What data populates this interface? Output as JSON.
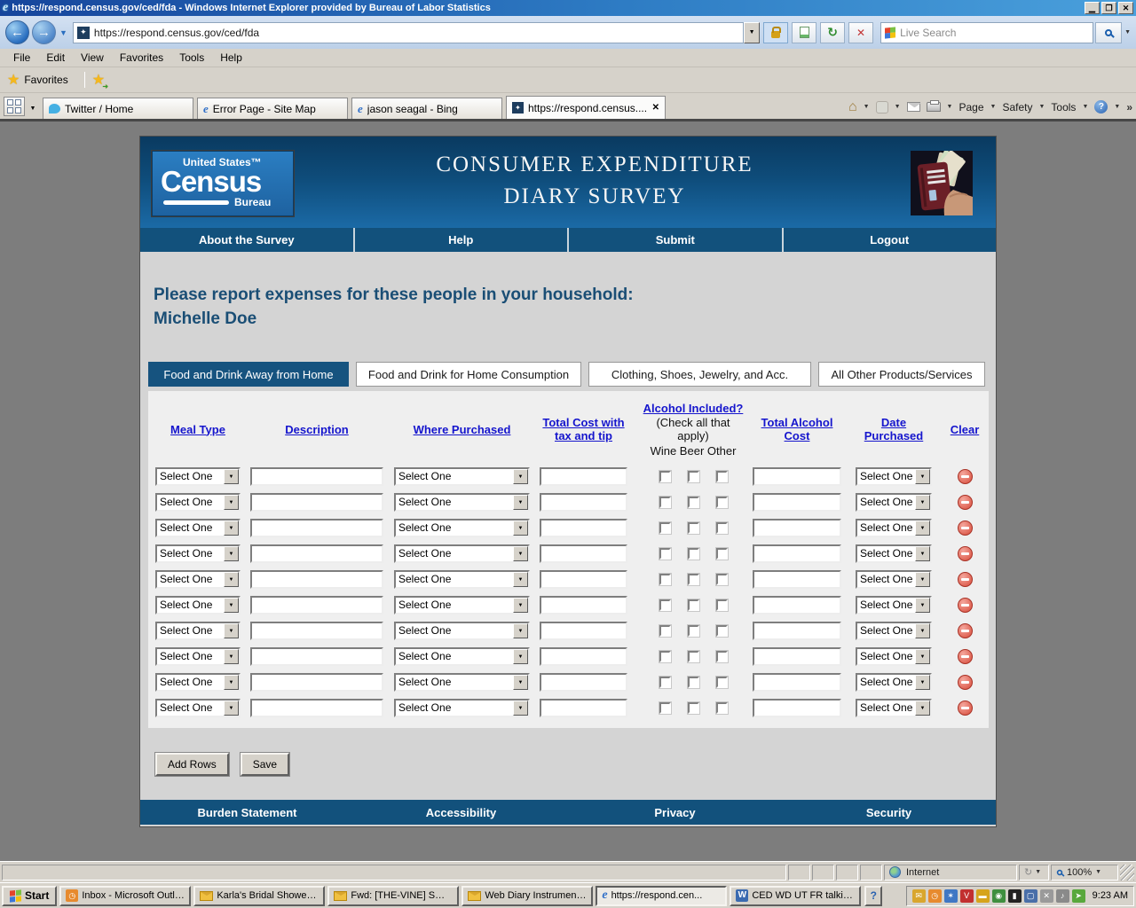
{
  "window": {
    "title": "https://respond.census.gov/ced/fda - Windows Internet Explorer provided by Bureau of Labor Statistics"
  },
  "browser": {
    "address_url": "https://respond.census.gov/ced/fda",
    "search": {
      "placeholder": "Live Search"
    },
    "menu_items": [
      "File",
      "Edit",
      "View",
      "Favorites",
      "Tools",
      "Help"
    ],
    "favorites_label": "Favorites",
    "tabs": [
      {
        "label": "Twitter / Home",
        "icon": "twitter",
        "active": false
      },
      {
        "label": "Error Page - Site Map",
        "icon": "ie",
        "active": false
      },
      {
        "label": "jason seagal - Bing",
        "icon": "ie",
        "active": false
      },
      {
        "label": "https://respond.census....",
        "icon": "census",
        "active": true
      }
    ],
    "toolbar": {
      "page_label": "Page",
      "safety_label": "Safety",
      "tools_label": "Tools"
    },
    "status": {
      "zone": "Internet",
      "zoom_level": "100%"
    }
  },
  "survey": {
    "logo": {
      "top": "United States™",
      "main": "Census",
      "sub": "Bureau"
    },
    "title_line1": "CONSUMER EXPENDITURE",
    "title_line2": "DIARY SURVEY",
    "nav_items": [
      "About the Survey",
      "Help",
      "Submit",
      "Logout"
    ],
    "heading_line1": "Please report expenses for these people in your household:",
    "heading_line2": "Michelle Doe",
    "category_tabs": [
      {
        "label": "Food and Drink Away from Home",
        "active": true
      },
      {
        "label": "Food and Drink for Home Consumption",
        "active": false
      },
      {
        "label": "Clothing, Shoes, Jewelry, and Acc.",
        "active": false
      },
      {
        "label": "All Other Products/Services",
        "active": false
      }
    ],
    "table": {
      "headers": {
        "meal_type": "Meal Type",
        "description": "Description",
        "where_purchased": "Where Purchased",
        "total_cost": "Total Cost with tax and tip",
        "alcohol_included": "Alcohol Included?",
        "alcohol_note": "(Check all that apply)",
        "alcohol_options": "Wine Beer Other",
        "total_alcohol_cost": "Total Alcohol Cost",
        "date_purchased": "Date Purchased",
        "clear": "Clear"
      },
      "rows": [
        {
          "meal_type": "Select One",
          "description": "",
          "where_purchased": "Select One",
          "total_cost": "",
          "wine_checked": false,
          "beer_checked": false,
          "other_checked": false,
          "total_alcohol_cost": "",
          "date_purchased": "Select One"
        },
        {
          "meal_type": "Select One",
          "description": "",
          "where_purchased": "Select One",
          "total_cost": "",
          "wine_checked": false,
          "beer_checked": false,
          "other_checked": false,
          "total_alcohol_cost": "",
          "date_purchased": "Select One"
        },
        {
          "meal_type": "Select One",
          "description": "",
          "where_purchased": "Select One",
          "total_cost": "",
          "wine_checked": false,
          "beer_checked": false,
          "other_checked": false,
          "total_alcohol_cost": "",
          "date_purchased": "Select One"
        },
        {
          "meal_type": "Select One",
          "description": "",
          "where_purchased": "Select One",
          "total_cost": "",
          "wine_checked": false,
          "beer_checked": false,
          "other_checked": false,
          "total_alcohol_cost": "",
          "date_purchased": "Select One"
        },
        {
          "meal_type": "Select One",
          "description": "",
          "where_purchased": "Select One",
          "total_cost": "",
          "wine_checked": false,
          "beer_checked": false,
          "other_checked": false,
          "total_alcohol_cost": "",
          "date_purchased": "Select One"
        },
        {
          "meal_type": "Select One",
          "description": "",
          "where_purchased": "Select One",
          "total_cost": "",
          "wine_checked": false,
          "beer_checked": false,
          "other_checked": false,
          "total_alcohol_cost": "",
          "date_purchased": "Select One"
        },
        {
          "meal_type": "Select One",
          "description": "",
          "where_purchased": "Select One",
          "total_cost": "",
          "wine_checked": false,
          "beer_checked": false,
          "other_checked": false,
          "total_alcohol_cost": "",
          "date_purchased": "Select One"
        },
        {
          "meal_type": "Select One",
          "description": "",
          "where_purchased": "Select One",
          "total_cost": "",
          "wine_checked": false,
          "beer_checked": false,
          "other_checked": false,
          "total_alcohol_cost": "",
          "date_purchased": "Select One"
        },
        {
          "meal_type": "Select One",
          "description": "",
          "where_purchased": "Select One",
          "total_cost": "",
          "wine_checked": false,
          "beer_checked": false,
          "other_checked": false,
          "total_alcohol_cost": "",
          "date_purchased": "Select One"
        },
        {
          "meal_type": "Select One",
          "description": "",
          "where_purchased": "Select One",
          "total_cost": "",
          "wine_checked": false,
          "beer_checked": false,
          "other_checked": false,
          "total_alcohol_cost": "",
          "date_purchased": "Select One"
        }
      ]
    },
    "buttons": {
      "add_rows": "Add Rows",
      "save": "Save"
    },
    "footer_items": [
      "Burden Statement",
      "Accessibility",
      "Privacy",
      "Security"
    ]
  },
  "taskbar": {
    "start_label": "Start",
    "buttons": [
      {
        "label": "Inbox - Microsoft Outlook",
        "icon": "outlook",
        "active": false
      },
      {
        "label": "Karla's Bridal Shower b...",
        "icon": "mail",
        "active": false
      },
      {
        "label": "Fwd: [THE-VINE] SWA...",
        "icon": "mail",
        "active": false
      },
      {
        "label": "Web Diary Instrument ...",
        "icon": "mail",
        "active": false
      },
      {
        "label": "https://respond.cen...",
        "icon": "ie",
        "active": true
      },
      {
        "label": "CED WD UT FR talking ...",
        "icon": "word",
        "active": false
      }
    ],
    "tray_icons": [
      {
        "name": "mail-icon",
        "glyph": "✉",
        "color": "#d9a62e"
      },
      {
        "name": "outlook-icon",
        "glyph": "◷",
        "color": "#e78a2e"
      },
      {
        "name": "messenger-icon",
        "glyph": "✶",
        "color": "#3f77c4"
      },
      {
        "name": "antivirus-icon",
        "glyph": "V",
        "color": "#c23030"
      },
      {
        "name": "lock-icon",
        "glyph": "▬",
        "color": "#d6a41c"
      },
      {
        "name": "gpu-icon",
        "glyph": "◉",
        "color": "#3f8f3f"
      },
      {
        "name": "device-icon",
        "glyph": "▮",
        "color": "#222222"
      },
      {
        "name": "display-icon",
        "glyph": "▢",
        "color": "#4a6fa8"
      },
      {
        "name": "no-audio-icon",
        "glyph": "✕",
        "color": "#9a9a9a"
      },
      {
        "name": "volume-icon",
        "glyph": "♪",
        "color": "#8a8a8a"
      },
      {
        "name": "update-icon",
        "glyph": "➤",
        "color": "#58a83c"
      }
    ],
    "tray_time": "9:23 AM"
  }
}
